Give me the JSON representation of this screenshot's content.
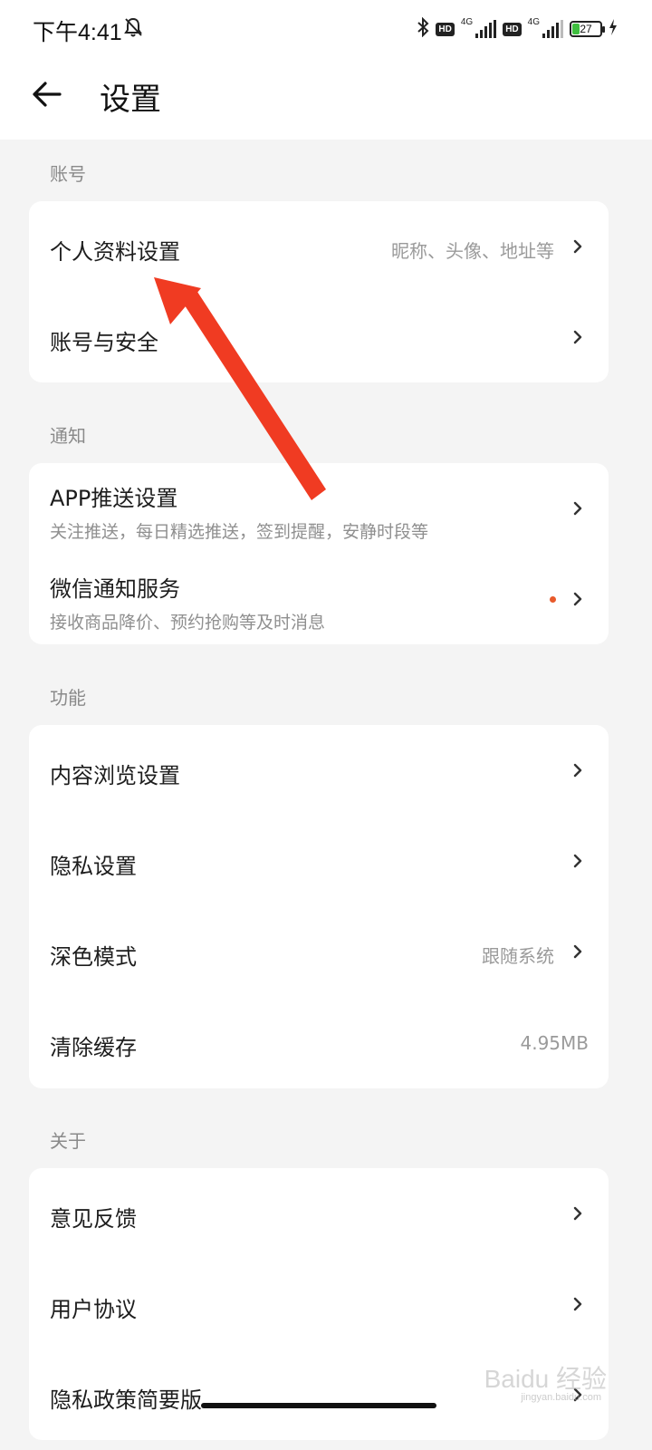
{
  "status_bar": {
    "time": "下午4:41",
    "battery": "27",
    "network_1": "4G",
    "network_2": "4G",
    "hd_1": "HD",
    "hd_2": "HD",
    "icons": [
      "bell-muted-icon",
      "bluetooth-icon",
      "signal-icon",
      "battery-icon",
      "charging-icon"
    ],
    "battery_level": 0.27
  },
  "header": {
    "back_icon": "arrow-left-icon",
    "title": "设置"
  },
  "sections": {
    "account": {
      "label": "账号",
      "items": [
        {
          "title": "个人资料设置",
          "value": "昵称、头像、地址等"
        },
        {
          "title": "账号与安全"
        }
      ]
    },
    "notify": {
      "label": "通知",
      "items": [
        {
          "title": "APP推送设置",
          "subtitle": "关注推送，每日精选推送，签到提醒，安静时段等"
        },
        {
          "title": "微信通知服务",
          "subtitle": "接收商品降价、预约抢购等及时消息"
        }
      ]
    },
    "feature": {
      "label": "功能",
      "items": [
        {
          "title": "内容浏览设置"
        },
        {
          "title": "隐私设置"
        },
        {
          "title": "深色模式",
          "value": "跟随系统"
        },
        {
          "title": "清除缓存",
          "value": "4.95MB"
        }
      ]
    },
    "about": {
      "label": "关于",
      "items": [
        {
          "title": "意见反馈"
        },
        {
          "title": "用户协议"
        },
        {
          "title": "隐私政策简要版"
        }
      ]
    }
  },
  "watermark": {
    "brand": "Baidu 经验",
    "url": "jingyan.baidu.com"
  },
  "colors": {
    "accent_dot": "#e85a2b",
    "annotation_arrow": "#f03b22",
    "page_bg": "#f4f4f4",
    "card_bg": "#ffffff"
  }
}
